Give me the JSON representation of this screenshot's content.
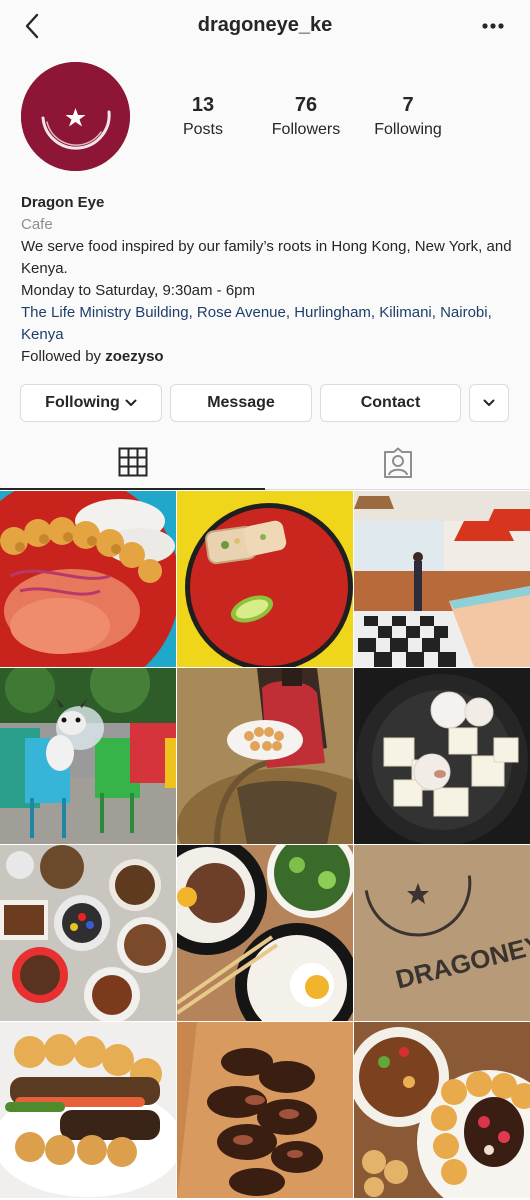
{
  "header": {
    "username": "dragoneye_ke",
    "back_icon": "chevron-left-icon",
    "more_icon": "more-horizontal-icon"
  },
  "profile": {
    "stats": [
      {
        "value": "13",
        "label": "Posts"
      },
      {
        "value": "76",
        "label": "Followers"
      },
      {
        "value": "7",
        "label": "Following"
      }
    ],
    "name": "Dragon Eye",
    "category": "Cafe",
    "bio_line1": "We serve food inspired by our family’s roots in Hong Kong, New York, and Kenya.",
    "hours": "Monday to Saturday, 9:30am - 6pm",
    "address": "The Life Ministry Building, Rose Avenue, Hurlingham, Kilimani, Nairobi, Kenya",
    "followed_by_prefix": "Followed by ",
    "followed_by_user": "zoezyso"
  },
  "actions": {
    "following": "Following",
    "message": "Message",
    "contact": "Contact"
  },
  "tabs": {
    "grid_icon": "grid-icon",
    "tagged_icon": "tagged-person-icon"
  },
  "colors": {
    "avatar_bg": "#8d1535",
    "link": "#1f3f6b",
    "muted": "#8e8e8e"
  },
  "posts": {
    "logo_text": "DRAGONEYE"
  }
}
